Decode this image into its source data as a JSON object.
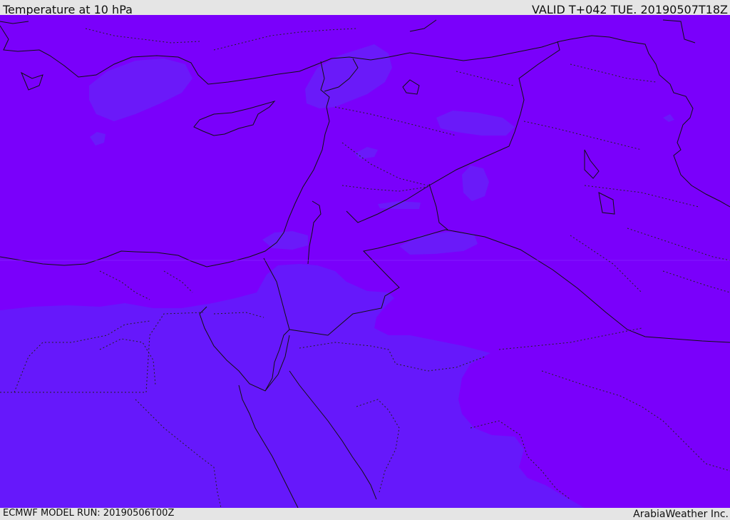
{
  "header": {
    "title": "Temperature at 10 hPa",
    "valid": "VALID T+042 TUE. 20190507T18Z"
  },
  "footer": {
    "run": "ECMWF MODEL RUN: 20190506T00Z",
    "credit": "ArabiaWeather Inc."
  },
  "colors": {
    "warm_fill": "#7a00fb",
    "cool_fill": "#6618fb",
    "borders": "#111111"
  }
}
